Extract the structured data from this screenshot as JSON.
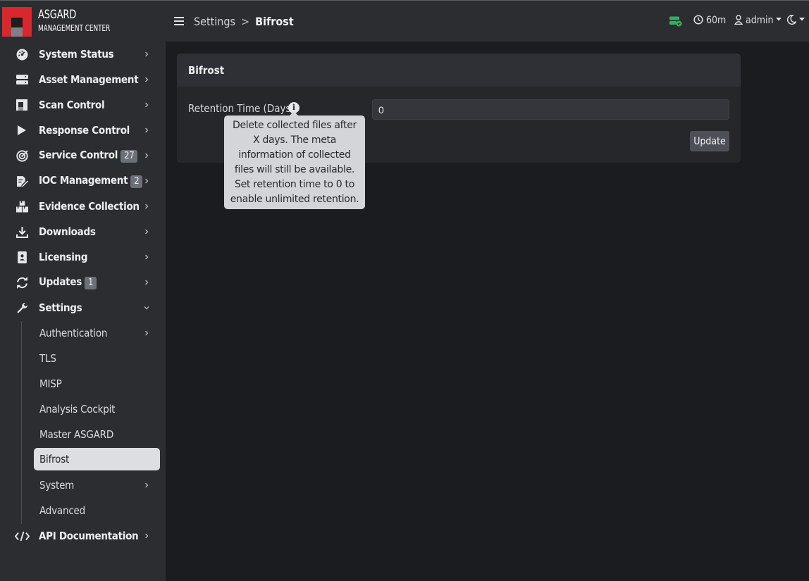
{
  "brand": {
    "line1": "ASGARD",
    "line2": "MANAGEMENT CENTER"
  },
  "sidebar": {
    "items": [
      {
        "label": "System Status",
        "icon": "gauge-icon"
      },
      {
        "label": "Asset Management",
        "icon": "server-icon"
      },
      {
        "label": "Scan Control",
        "icon": "scan-icon"
      },
      {
        "label": "Response Control",
        "icon": "play-icon"
      },
      {
        "label": "Service Control",
        "icon": "target-icon",
        "badge": "27"
      },
      {
        "label": "IOC Management",
        "icon": "edit-file-icon",
        "badge": "2"
      },
      {
        "label": "Evidence Collection",
        "icon": "boxes-icon"
      },
      {
        "label": "Downloads",
        "icon": "download-icon"
      },
      {
        "label": "Licensing",
        "icon": "id-card-icon"
      },
      {
        "label": "Updates",
        "icon": "sync-icon",
        "badge": "1"
      },
      {
        "label": "Settings",
        "icon": "wrench-icon"
      }
    ],
    "settings_sub": [
      {
        "label": "Authentication"
      },
      {
        "label": "TLS"
      },
      {
        "label": "MISP"
      },
      {
        "label": "Analysis Cockpit"
      },
      {
        "label": "Master ASGARD"
      },
      {
        "label": "Bifrost"
      },
      {
        "label": "System"
      },
      {
        "label": "Advanced"
      }
    ],
    "api": {
      "label": "API Documentation",
      "icon": "code-icon"
    }
  },
  "topbar": {
    "breadcrumb_parent": "Settings",
    "breadcrumb_sep": ">",
    "breadcrumb_current": "Bifrost",
    "timer": "60m",
    "user": "admin"
  },
  "card": {
    "title": "Bifrost",
    "field_label": "Retention Time (Days)",
    "field_value": "0",
    "update_label": "Update"
  },
  "tooltip": {
    "text": "Delete collected files after X days. The meta information of collected files will still be available. Set retention time to 0 to enable unlimited retention."
  },
  "colors": {
    "brand_red": "#d8272d",
    "status_green": "#2fb35a",
    "active_sub_bg": "#dcdee2"
  }
}
